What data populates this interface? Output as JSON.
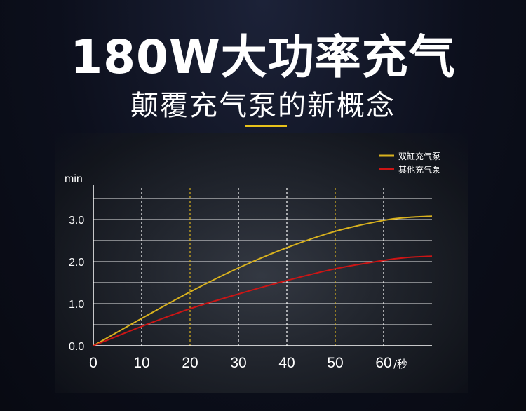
{
  "headline": "180W大功率充气",
  "subheadline": "颠覆充气泵的新概念",
  "colors": {
    "accent": "#e8c21a",
    "series_dual": "#d9b21e",
    "series_other": "#cc1515",
    "grid": "#ffffff"
  },
  "chart_data": {
    "type": "line",
    "title": "",
    "xlabel": "",
    "ylabel": "min",
    "x_ticks": [
      "0",
      "10",
      "20",
      "30",
      "40",
      "50",
      "60"
    ],
    "x_unit": "/秒",
    "y_ticks": [
      "0.0",
      "1.0",
      "2.0",
      "3.0"
    ],
    "xlim": [
      0,
      70
    ],
    "ylim": [
      0,
      3.75
    ],
    "grid": true,
    "legend_position": "top-right",
    "series": [
      {
        "name": "双缸充气泵",
        "color": "#d9b21e",
        "x": [
          0,
          10,
          20,
          30,
          40,
          50,
          60,
          65,
          70
        ],
        "y": [
          0,
          0.65,
          1.28,
          1.85,
          2.33,
          2.72,
          2.98,
          3.05,
          3.08
        ]
      },
      {
        "name": "其他充气泵",
        "color": "#cc1515",
        "x": [
          0,
          10,
          20,
          30,
          40,
          50,
          60,
          65,
          70
        ],
        "y": [
          0,
          0.46,
          0.88,
          1.23,
          1.55,
          1.83,
          2.03,
          2.1,
          2.13
        ]
      }
    ]
  }
}
